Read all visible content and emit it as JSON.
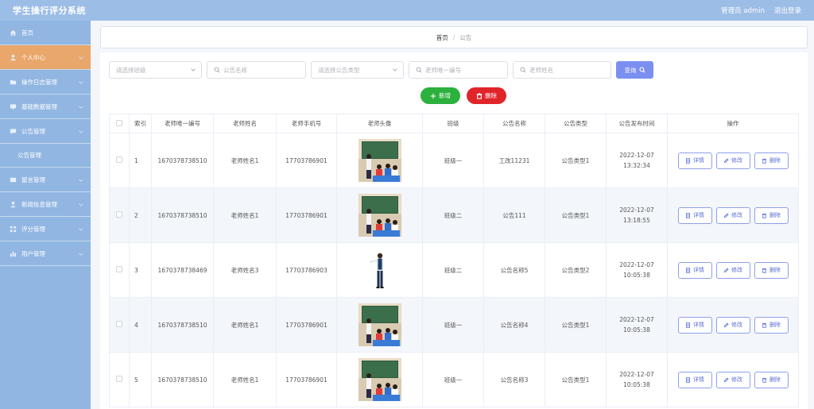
{
  "header": {
    "title": "学生操行评分系统",
    "admin": "管理员 admin",
    "logout": "退出登录"
  },
  "sidebar": {
    "items": [
      {
        "label": "首页",
        "icon": "home-icon"
      },
      {
        "label": "个人中心",
        "icon": "user-icon",
        "active": true
      },
      {
        "label": "操作日志管理",
        "icon": "folder-icon"
      },
      {
        "label": "基础数据管理",
        "icon": "monitor-icon"
      },
      {
        "label": "公告管理",
        "icon": "chat-icon"
      },
      {
        "label": "公告管理",
        "sub": true
      },
      {
        "label": "留言管理",
        "icon": "mail-icon"
      },
      {
        "label": "新闻信息管理",
        "icon": "person-icon"
      },
      {
        "label": "评分管理",
        "icon": "grid-icon"
      },
      {
        "label": "用户管理",
        "icon": "chart-icon"
      }
    ]
  },
  "breadcrumb": {
    "home": "首页",
    "sep": "/",
    "current": "公告"
  },
  "filters": {
    "class_placeholder": "请选择班级",
    "notice_name_placeholder": "公告名称",
    "notice_type_placeholder": "请选择公告类型",
    "teacher_id_placeholder": "老师唯一编号",
    "teacher_name_placeholder": "老师姓名",
    "query_label": "查询"
  },
  "actions": {
    "add_label": "新增",
    "delete_label": "删除"
  },
  "table": {
    "headers": [
      "",
      "索引",
      "老师唯一编号",
      "老师姓名",
      "老师手机号",
      "老师头像",
      "班级",
      "公告名称",
      "公告类型",
      "公告发布时间",
      "操作"
    ],
    "op_labels": {
      "detail": "详情",
      "edit": "修改",
      "delete": "删除"
    },
    "rows": [
      {
        "index": "1",
        "teacher_id": "1670378738510",
        "teacher_name": "老师姓名1",
        "phone": "17703786901",
        "avatar": "classroom",
        "class": "班级一",
        "notice_name": "工改11231",
        "notice_type": "公告类型1",
        "time": "2022-12-07 13:32:34"
      },
      {
        "index": "2",
        "teacher_id": "1670378738510",
        "teacher_name": "老师姓名1",
        "phone": "17703786901",
        "avatar": "classroom",
        "class": "班级二",
        "notice_name": "公告111",
        "notice_type": "公告类型1",
        "time": "2022-12-07 13:18:55"
      },
      {
        "index": "3",
        "teacher_id": "1670378738469",
        "teacher_name": "老师姓名3",
        "phone": "17703786903",
        "avatar": "standing",
        "class": "班级二",
        "notice_name": "公告名称5",
        "notice_type": "公告类型2",
        "time": "2022-12-07 10:05:38"
      },
      {
        "index": "4",
        "teacher_id": "1670378738510",
        "teacher_name": "老师姓名1",
        "phone": "17703786901",
        "avatar": "classroom",
        "class": "班级一",
        "notice_name": "公告名称4",
        "notice_type": "公告类型1",
        "time": "2022-12-07 10:05:38"
      },
      {
        "index": "5",
        "teacher_id": "1670378738510",
        "teacher_name": "老师姓名1",
        "phone": "17703786901",
        "avatar": "classroom",
        "class": "班级一",
        "notice_name": "公告名称3",
        "notice_type": "公告类型1",
        "time": "2022-12-07 10:05:38"
      }
    ]
  },
  "colors": {
    "header": "#9cbde6",
    "sidebar": "#91b6e2",
    "active": "#e9a76b",
    "query": "#7b8ff0",
    "add": "#2bb13c",
    "delete": "#e0242a",
    "op": "#5a6fd8"
  }
}
